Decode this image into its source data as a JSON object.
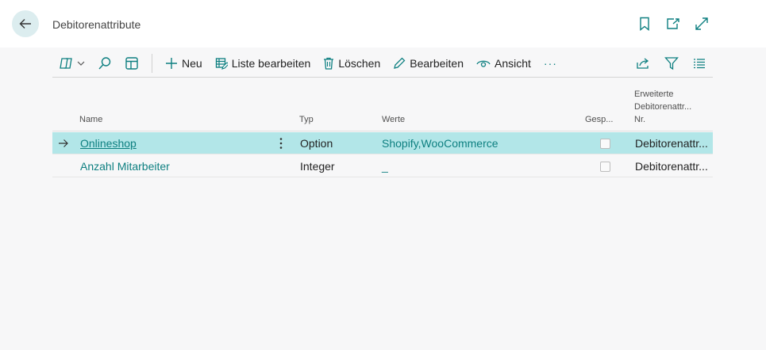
{
  "header": {
    "title": "Debitorenattribute"
  },
  "toolbar": {
    "new_label": "Neu",
    "edit_list_label": "Liste bearbeiten",
    "delete_label": "Löschen",
    "edit_label": "Bearbeiten",
    "view_label": "Ansicht",
    "more_label": "···"
  },
  "table": {
    "columns": {
      "name": "Name",
      "typ": "Typ",
      "werte": "Werte",
      "gesp": "Gesp...",
      "ext_line1": "Erweiterte",
      "ext_line2": "Debitorenattr...",
      "ext_line3": "Nr."
    },
    "rows": [
      {
        "name": "Onlineshop",
        "typ": "Option",
        "werte": "Shopify,WooCommerce",
        "gesperrt": false,
        "ext": "Debitorenattr..."
      },
      {
        "name": "Anzahl Mitarbeiter",
        "typ": "Integer",
        "werte": "_",
        "gesperrt": false,
        "ext": "Debitorenattr..."
      }
    ]
  },
  "colors": {
    "accent": "#0d7f80",
    "selected_row": "#b2e6e8",
    "back_button_bg": "#dcedef"
  }
}
